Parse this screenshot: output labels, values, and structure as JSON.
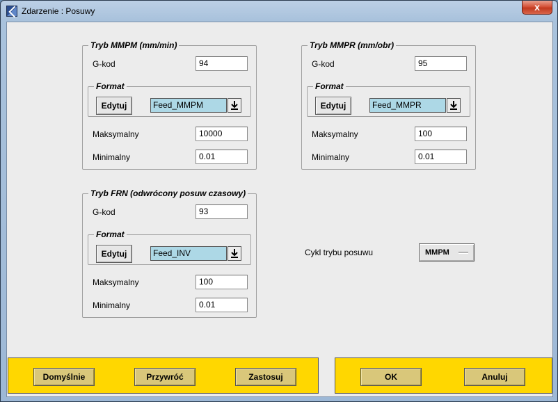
{
  "window": {
    "title": "Zdarzenie : Posuwy",
    "close_glyph": "x"
  },
  "mmpm": {
    "title": "Tryb MMPM (mm/min)",
    "gcode_label": "G-kod",
    "gcode_value": "94",
    "format_title": "Format",
    "edit_label": "Edytuj",
    "format_value": "Feed_MMPM",
    "max_label": "Maksymalny",
    "max_value": "10000",
    "min_label": "Minimalny",
    "min_value": "0.01"
  },
  "mmpr": {
    "title": "Tryb MMPR (mm/obr)",
    "gcode_label": "G-kod",
    "gcode_value": "95",
    "format_title": "Format",
    "edit_label": "Edytuj",
    "format_value": "Feed_MMPR",
    "max_label": "Maksymalny",
    "max_value": "100",
    "min_label": "Minimalny",
    "min_value": "0.01"
  },
  "frn": {
    "title": "Tryb FRN (odwrócony posuw czasowy)",
    "gcode_label": "G-kod",
    "gcode_value": "93",
    "format_title": "Format",
    "edit_label": "Edytuj",
    "format_value": "Feed_INV",
    "max_label": "Maksymalny",
    "max_value": "100",
    "min_label": "Minimalny",
    "min_value": "0.01"
  },
  "cycle": {
    "label": "Cykl trybu posuwu",
    "value": "MMPM"
  },
  "footer": {
    "defaults_label": "Domyślnie",
    "restore_label": "Przywróć",
    "apply_label": "Zastosuj",
    "ok_label": "OK",
    "cancel_label": "Anuluj"
  },
  "colors": {
    "footer_bar": "#ffd700",
    "format_select": "#add8e6",
    "close_button": "#c9462c"
  },
  "icons": {
    "window": "app-icon",
    "close": "close-icon",
    "dropdown": "download-arrow-icon"
  }
}
